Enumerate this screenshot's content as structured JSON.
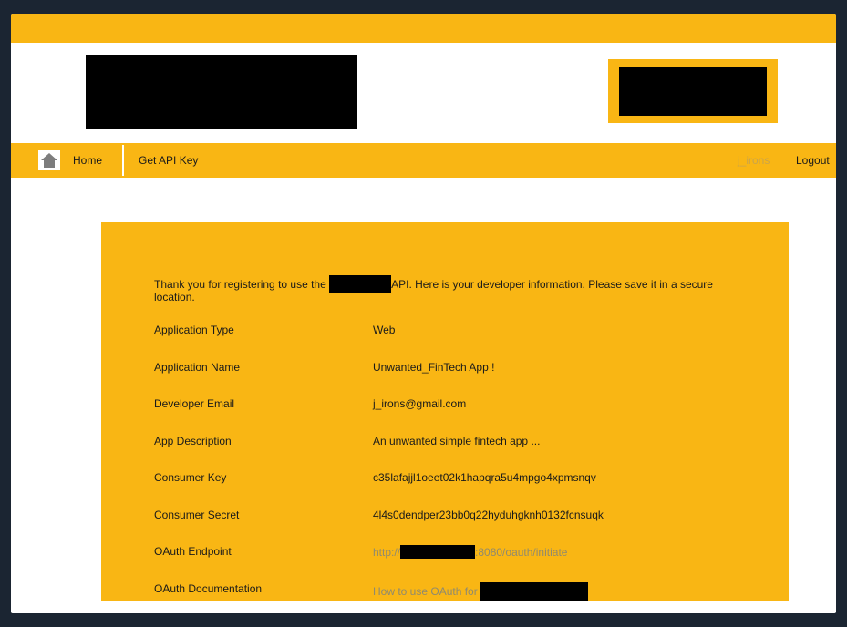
{
  "nav": {
    "home_label": "Home",
    "get_api_key_label": "Get API Key",
    "username": "j_irons",
    "logout_label": "Logout"
  },
  "intro": {
    "text_before": "Thank you for registering to use the",
    "text_after": "API. Here is your developer information. Please save it in a secure location."
  },
  "details": [
    {
      "label": "Application Type",
      "value": "Web"
    },
    {
      "label": "Application Name",
      "value": "Unwanted_FinTech App !"
    },
    {
      "label": "Developer Email",
      "value": "j_irons@gmail.com"
    },
    {
      "label": "App Description",
      "value": "An unwanted simple fintech app ..."
    },
    {
      "label": "Consumer Key",
      "value": "c35lafajjl1oeet02k1hapqra5u4mpgo4xpmsnqv"
    },
    {
      "label": "Consumer Secret",
      "value": "4l4s0dendper23bb0q22hyduhgknh0132fcnsuqk"
    }
  ],
  "oauth": {
    "endpoint_label": "OAuth Endpoint",
    "endpoint_prefix": "http://",
    "endpoint_suffix": ":8080/oauth/initiate",
    "doc_label": "OAuth Documentation",
    "doc_link_text": "How to use OAuth for"
  },
  "colors": {
    "accent": "#f9b614",
    "background": "#1b2532",
    "link": "#8f8a6f"
  }
}
